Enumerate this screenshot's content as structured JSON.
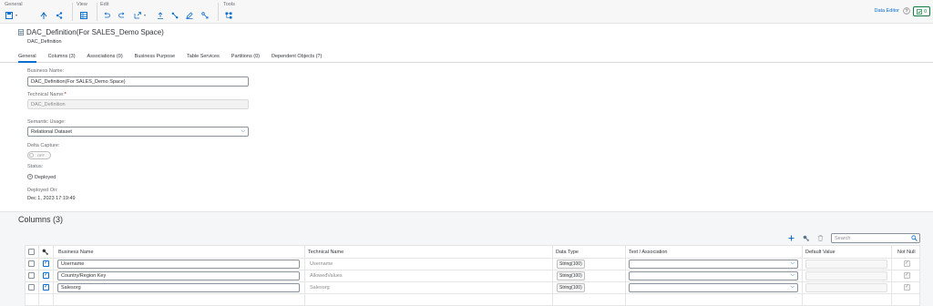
{
  "toolbar": {
    "groups": {
      "general": "General",
      "view": "View",
      "edit": "Edit",
      "tools": "Tools"
    },
    "data_editor": "Data Editor",
    "badge_count": "0"
  },
  "header": {
    "title": "DAC_Definition(For SALES_Demo Space)",
    "subtitle": "DAC_Definition",
    "tabs": [
      {
        "label": "General",
        "active": true
      },
      {
        "label": "Columns (3)"
      },
      {
        "label": "Associations (0)"
      },
      {
        "label": "Business Purpose"
      },
      {
        "label": "Table Services"
      },
      {
        "label": "Partitions (0)"
      },
      {
        "label": "Dependent Objects (?)"
      }
    ]
  },
  "general": {
    "business_name_label": "Business Name:",
    "business_name_value": "DAC_Definition(For SALES_Demo Space)",
    "technical_name_label": "Technical Name:",
    "technical_name_required": "*",
    "technical_name_value": "DAC_Definition",
    "semantic_usage_label": "Semantic Usage:",
    "semantic_usage_value": "Relational Dataset",
    "delta_capture_label": "Delta Capture:",
    "delta_capture_toggle": "OFF",
    "status_label": "Status:",
    "status_value": "Deployed",
    "deployed_on_label": "Deployed On:",
    "deployed_on_value": "Dec 1, 2023 17:19:49"
  },
  "columns": {
    "title": "Columns (3)",
    "search_placeholder": "Search",
    "headers": {
      "business_name": "Business Name",
      "technical_name": "Technical Name",
      "data_type": "Data Type",
      "text_association": "Text / Association",
      "default_value": "Default Value",
      "not_null": "Not Null"
    },
    "rows": [
      {
        "business_name": "Username",
        "technical_name": "Username",
        "data_type": "String(100)",
        "key": true,
        "not_null": true
      },
      {
        "business_name": "Country/Region Key",
        "technical_name": "AllowedValues",
        "data_type": "String(100)",
        "key": true,
        "not_null": true
      },
      {
        "business_name": "Salesorg",
        "technical_name": "Salesorg",
        "data_type": "String(100)",
        "key": true,
        "not_null": true
      }
    ]
  }
}
